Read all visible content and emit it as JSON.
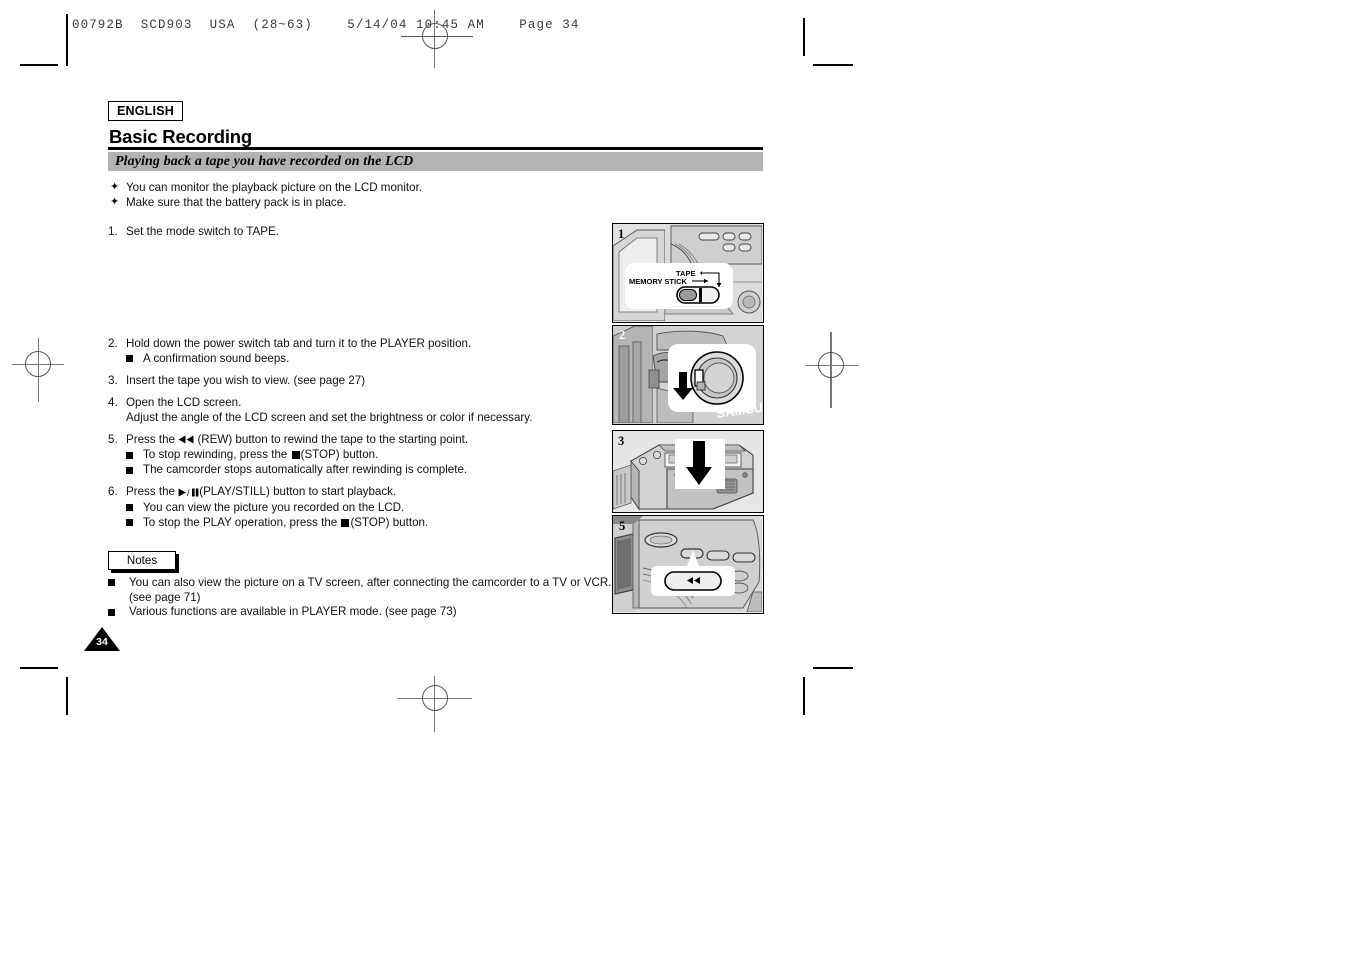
{
  "film_header": "00792B  SCD903  USA  (28~63)    5/14/04 10:45 AM    Page 34",
  "language_badge": "ENGLISH",
  "page_title": "Basic Recording",
  "section_title": "Playing back a tape you have recorded on the LCD",
  "intro_bullets": [
    {
      "marker": "✦",
      "text": "You can monitor the playback picture on the LCD monitor."
    },
    {
      "marker": "✦",
      "text": "Make sure that the battery pack is in place."
    }
  ],
  "steps": [
    {
      "number": "1.",
      "text": "Set the mode switch to TAPE.",
      "sub": []
    },
    {
      "number": "2.",
      "text": "Hold down the power switch tab and turn it to the PLAYER position.",
      "sub": [
        "A confirmation sound beeps."
      ]
    },
    {
      "number": "3.",
      "text": "Insert the tape you wish to view. (see page 27)",
      "sub": []
    },
    {
      "number": "4.",
      "text": "Open the LCD screen.",
      "text2": "Adjust the angle of the LCD screen and set the brightness or color if necessary.",
      "sub": []
    },
    {
      "number": "5.",
      "text_pre": "Press the ",
      "text_post": "(REW) button to rewind the tape to the starting point.",
      "sub_rich": [
        {
          "pre": "To stop rewinding, press the ",
          "post": "(STOP) button."
        },
        {
          "pre": "The camcorder stops automatically after rewinding is complete.",
          "post": ""
        }
      ]
    },
    {
      "number": "6.",
      "text_pre": "Press the ",
      "text_post": "(PLAY/STILL) button to start playback.",
      "sub_rich": [
        {
          "pre": "You can view the picture you recorded on the LCD.",
          "post": ""
        },
        {
          "pre": "To stop the PLAY operation, press the ",
          "post": "(STOP) button."
        }
      ]
    }
  ],
  "notes": {
    "label": "Notes",
    "items": [
      "You can also view the picture on a TV screen, after connecting the camcorder to a TV or VCR.",
      "(see page 71)",
      "Various functions are available in PLAYER mode. (see page 73)"
    ]
  },
  "page_number": "34",
  "illustrations": [
    {
      "number": "1",
      "labels": [
        "TAPE",
        "MEMORY STICK"
      ],
      "caption": "mode switch detail with TAPE / MEMORY STICK slider"
    },
    {
      "number": "2",
      "labels": [],
      "caption": "power switch dial rotated to PLAYER position"
    },
    {
      "number": "3",
      "labels": [],
      "caption": "tape cassette inserted into camcorder compartment"
    },
    {
      "number": "5",
      "labels": [],
      "caption": "REW button on camcorder body callout"
    }
  ],
  "colors": {
    "banner_gray": "#b3b3b3",
    "ink": "#000000",
    "panel_bg": "#e9e9e9"
  }
}
